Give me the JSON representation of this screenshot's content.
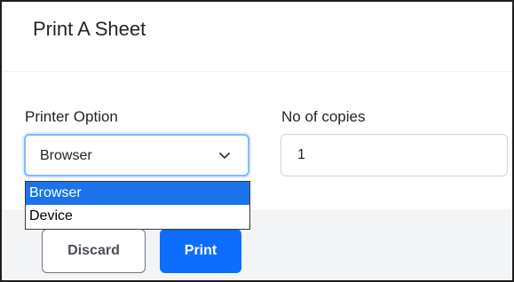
{
  "dialog": {
    "title": "Print A Sheet"
  },
  "form": {
    "printer_option": {
      "label": "Printer Option",
      "selected_value": "Browser",
      "options": [
        "Browser",
        "Device"
      ],
      "highlighted_option": "Browser",
      "icon": "chevron-down-icon"
    },
    "copies": {
      "label": "No of copies",
      "value": "1"
    }
  },
  "footer": {
    "discard_label": "Discard",
    "print_label": "Print"
  },
  "colors": {
    "primary": "#0d6efd",
    "focus_border": "#86b7fe",
    "highlight": "#1a73e8",
    "footer_bg": "#f3f4f6"
  }
}
